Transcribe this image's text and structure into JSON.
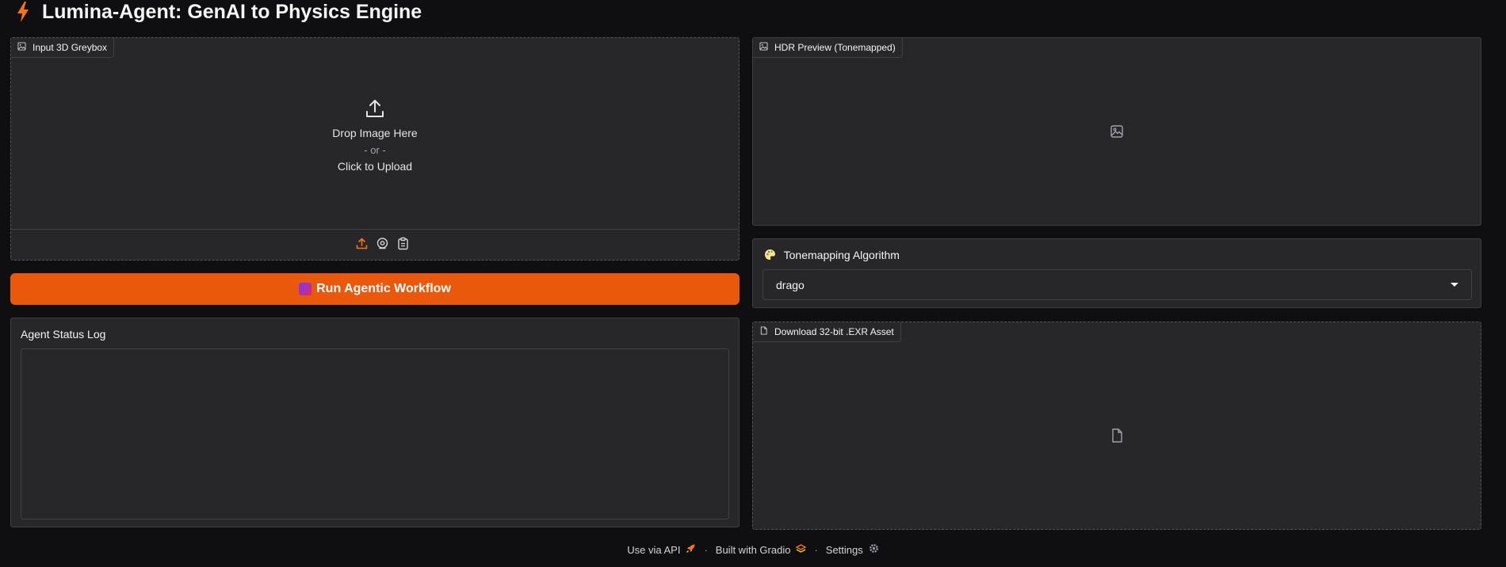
{
  "app": {
    "title": "Lumina-Agent: GenAI to Physics Engine"
  },
  "input_panel": {
    "label": "Input 3D Greybox",
    "drop_text": "Drop Image Here",
    "or_text": "- or -",
    "click_text": "Click to Upload",
    "tools": [
      "upload-icon",
      "webcam-icon",
      "clipboard-icon"
    ]
  },
  "run_button": {
    "label": "Run Agentic Workflow",
    "emoji": "clapper-emoji"
  },
  "status_log": {
    "label": "Agent Status Log",
    "value": ""
  },
  "hdr_preview": {
    "label": "HDR Preview (Tonemapped)"
  },
  "tonemapping": {
    "label": "Tonemapping Algorithm",
    "selected": "drago"
  },
  "download": {
    "label": "Download 32-bit .EXR Asset"
  },
  "footer": {
    "api": "Use via API",
    "built": "Built with Gradio",
    "settings": "Settings",
    "separator": "·"
  },
  "colors": {
    "accent": "#ea580c",
    "background": "#0f0f11",
    "panel": "#27272a",
    "border": "#3f3f46"
  }
}
